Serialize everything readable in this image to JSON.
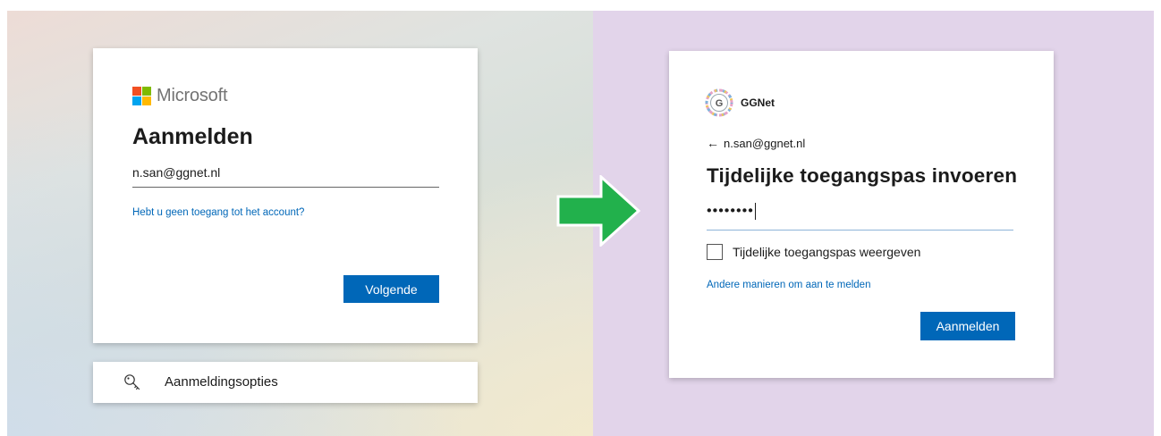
{
  "colors": {
    "accent_blue": "#0067b8",
    "arrow_green": "#22b14c",
    "right_background": "#e2d4ea",
    "ms_red": "#f25022",
    "ms_green": "#7fba00",
    "ms_blue": "#00a4ef",
    "ms_yellow": "#ffb900"
  },
  "microsoft": {
    "brand": "Microsoft",
    "logo_icon": "microsoft-logo-icon",
    "title": "Aanmelden",
    "email_value": "n.san@ggnet.nl",
    "no_access_link": "Hebt u geen toegang tot het account?",
    "next_button": "Volgende"
  },
  "signin_options": {
    "icon": "key-icon",
    "label": "Aanmeldingsopties"
  },
  "transition_arrow": {
    "icon": "arrow-right-icon"
  },
  "ggnet": {
    "brand": "GGNet",
    "logo_icon": "ggnet-logo-icon",
    "back_icon": "back-arrow-icon",
    "back_arrow": "←",
    "email": "n.san@ggnet.nl",
    "title": "Tijdelijke toegangspas invoeren",
    "password_value": "••••••••",
    "show_pass_checkbox_label": "Tijdelijke toegangspas weergeven",
    "show_pass_checked": false,
    "other_methods_link": "Andere manieren om aan te melden",
    "submit_button": "Aanmelden"
  }
}
